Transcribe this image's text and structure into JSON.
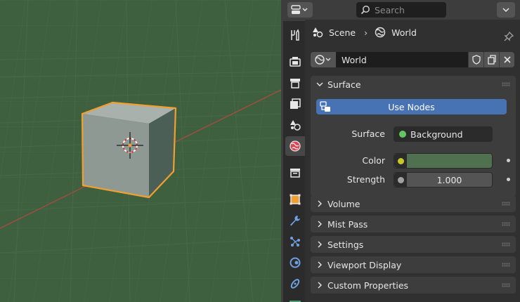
{
  "header": {
    "search_placeholder": "Search"
  },
  "breadcrumb": {
    "scene_label": "Scene",
    "world_label": "World"
  },
  "world_selector": {
    "name": "World"
  },
  "panels": {
    "surface": {
      "title": "Surface",
      "use_nodes_label": "Use Nodes",
      "surface_label": "Surface",
      "surface_value": "Background",
      "surface_socket_color": "#63c763",
      "color_label": "Color",
      "color_socket_color": "#c7c729",
      "color_value_swatch": "#4f7150",
      "strength_label": "Strength",
      "strength_value": "1.000",
      "strength_socket_color": "#a1a1a1"
    },
    "collapsed": [
      {
        "title": "Volume"
      },
      {
        "title": "Mist Pass"
      },
      {
        "title": "Settings"
      },
      {
        "title": "Viewport Display"
      },
      {
        "title": "Custom Properties"
      }
    ]
  },
  "colors": {
    "viewport_bg": "#3f603f",
    "accent_blue": "#4772b3",
    "selection_orange": "#f0a030",
    "active_tab_world_red": "#d94552"
  },
  "tabs": [
    {
      "name": "tool-tab"
    },
    {
      "name": "render-tab"
    },
    {
      "name": "output-tab"
    },
    {
      "name": "view-layer-tab"
    },
    {
      "name": "scene-tab"
    },
    {
      "name": "world-tab"
    },
    {
      "name": "collection-tab"
    },
    {
      "name": "object-tab"
    },
    {
      "name": "modifiers-tab"
    },
    {
      "name": "particles-tab"
    },
    {
      "name": "physics-tab"
    },
    {
      "name": "constraints-tab"
    },
    {
      "name": "data-tab"
    }
  ]
}
